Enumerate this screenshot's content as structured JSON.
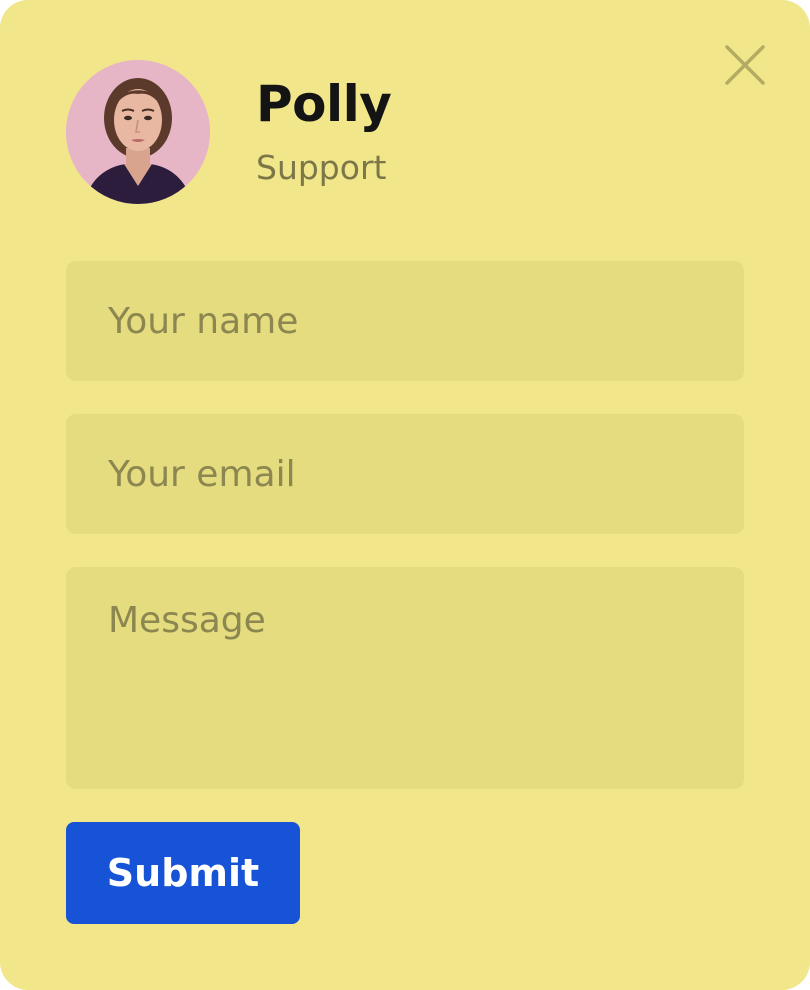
{
  "agent": {
    "name": "Polly",
    "role": "Support",
    "avatar_icon": "person-portrait-icon"
  },
  "close_icon": "close-icon",
  "form": {
    "name_placeholder": "Your name",
    "email_placeholder": "Your email",
    "message_placeholder": "Message",
    "submit_label": "Submit"
  },
  "colors": {
    "card_background": "#f1e68a",
    "field_background": "#e4dc7e",
    "submit_background": "#1753d6",
    "submit_text": "#ffffff",
    "name_text": "#141414",
    "muted_text": "#7c7748"
  }
}
